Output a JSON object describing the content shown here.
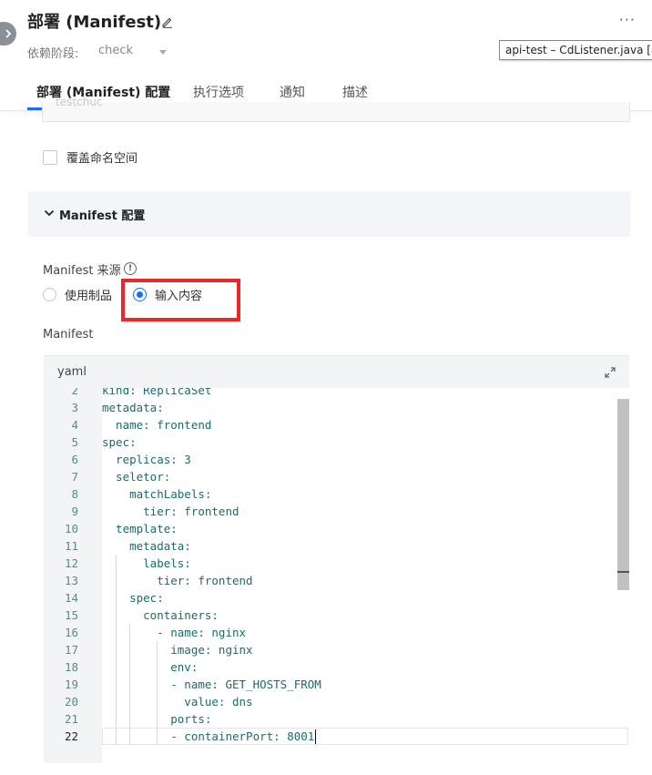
{
  "header": {
    "title": "部署 (Manifest)",
    "dependency_label": "依赖阶段:",
    "dependency_value": "check",
    "more": "···"
  },
  "tooltip": "api-test – CdListener.java [a",
  "tabs": [
    {
      "label": "部署 (Manifest) 配置",
      "active": true
    },
    {
      "label": "执行选项",
      "active": false
    },
    {
      "label": "通知",
      "active": false
    },
    {
      "label": "描述",
      "active": false
    }
  ],
  "partial_input_value": "testchuc",
  "override_namespace": {
    "label": "覆盖命名空间",
    "checked": false
  },
  "section": {
    "title": "Manifest 配置",
    "expanded": true
  },
  "source": {
    "label": "Manifest 来源",
    "options": [
      {
        "label": "使用制品",
        "selected": false
      },
      {
        "label": "输入内容",
        "selected": true
      }
    ]
  },
  "manifest_label": "Manifest",
  "editor": {
    "language": "yaml",
    "lines": [
      {
        "n": "2",
        "text": "kind: ReplicaSet"
      },
      {
        "n": "3",
        "text": "metadata:"
      },
      {
        "n": "4",
        "text": "  name: frontend"
      },
      {
        "n": "5",
        "text": "spec:"
      },
      {
        "n": "6",
        "text": "  replicas: 3"
      },
      {
        "n": "7",
        "text": "  seletor:"
      },
      {
        "n": "8",
        "text": "    matchLabels:"
      },
      {
        "n": "9",
        "text": "      tier: frontend"
      },
      {
        "n": "10",
        "text": "  template:"
      },
      {
        "n": "11",
        "text": "    metadata:"
      },
      {
        "n": "12",
        "text": "      labels:"
      },
      {
        "n": "13",
        "text": "        tier: frontend"
      },
      {
        "n": "14",
        "text": "    spec:"
      },
      {
        "n": "15",
        "text": "      containers:"
      },
      {
        "n": "16",
        "text": "        - name: nginx"
      },
      {
        "n": "17",
        "text": "          image: nginx"
      },
      {
        "n": "18",
        "text": "          env:"
      },
      {
        "n": "19",
        "text": "          - name: GET_HOSTS_FROM"
      },
      {
        "n": "20",
        "text": "            value: dns"
      },
      {
        "n": "21",
        "text": "          ports:"
      },
      {
        "n": "22",
        "text": "          - containerPort: 8001",
        "current": true
      }
    ]
  },
  "colors": {
    "accent": "#1a6cff",
    "highlight": "#e8282b"
  }
}
